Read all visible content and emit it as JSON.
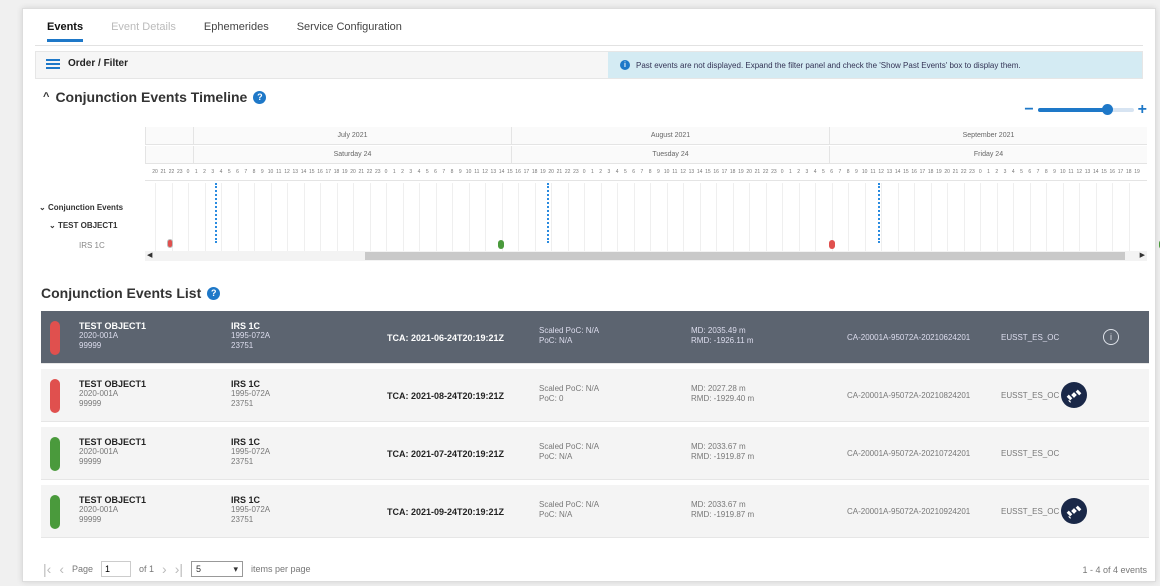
{
  "tabs": [
    {
      "label": "Events",
      "state": "active"
    },
    {
      "label": "Event Details",
      "state": "disabled"
    },
    {
      "label": "Ephemerides",
      "state": "normal"
    },
    {
      "label": "Service Configuration",
      "state": "normal"
    }
  ],
  "filter": {
    "label": "Order / Filter",
    "notice": "Past events are not displayed. Expand the filter panel and check the 'Show Past Events' box to display them."
  },
  "timeline": {
    "title": "Conjunction Events Timeline",
    "months": [
      "July 2021",
      "August 2021",
      "September 2021"
    ],
    "days": [
      "Saturday 24",
      "Tuesday 24",
      "Friday 24"
    ],
    "tree": [
      "Conjunction Events",
      "TEST OBJECT1",
      "IRS 1C"
    ],
    "zoom_level": 0.72
  },
  "colors": {
    "accent": "#1e78c8",
    "red": "#e0504e",
    "green": "#4a9a3c",
    "selected_row": "#5c6470"
  },
  "list": {
    "title": "Conjunction Events List",
    "rows": [
      {
        "primary": "TEST OBJECT1",
        "p_id": "2020-001A",
        "p_num": "99999",
        "secondary": "IRS 1C",
        "s_id": "1995-072A",
        "s_num": "23751",
        "tca": "TCA: 2021-06-24T20:19:21Z",
        "spoc": "Scaled PoC: N/A",
        "poc": "PoC: N/A",
        "md": "MD: 2035.49 m",
        "rmd": "RMD: -1926.11 m",
        "cdm": "CA-20001A-95072A-20210624201",
        "service": "EUSST_ES_OC",
        "status": "red",
        "selected": true,
        "action": "info-icon"
      },
      {
        "primary": "TEST OBJECT1",
        "p_id": "2020-001A",
        "p_num": "99999",
        "secondary": "IRS 1C",
        "s_id": "1995-072A",
        "s_num": "23751",
        "tca": "TCA: 2021-08-24T20:19:21Z",
        "spoc": "Scaled PoC: N/A",
        "poc": "PoC: 0",
        "md": "MD: 2027.28 m",
        "rmd": "RMD: -1929.40 m",
        "cdm": "CA-20001A-95072A-20210824201",
        "service": "EUSST_ES_OC",
        "status": "red",
        "selected": false,
        "action": "satellite-icon"
      },
      {
        "primary": "TEST OBJECT1",
        "p_id": "2020-001A",
        "p_num": "99999",
        "secondary": "IRS 1C",
        "s_id": "1995-072A",
        "s_num": "23751",
        "tca": "TCA: 2021-07-24T20:19:21Z",
        "spoc": "Scaled PoC: N/A",
        "poc": "PoC: N/A",
        "md": "MD: 2033.67 m",
        "rmd": "RMD: -1919.87 m",
        "cdm": "CA-20001A-95072A-20210724201",
        "service": "EUSST_ES_OC",
        "status": "green",
        "selected": false,
        "action": ""
      },
      {
        "primary": "TEST OBJECT1",
        "p_id": "2020-001A",
        "p_num": "99999",
        "secondary": "IRS 1C",
        "s_id": "1995-072A",
        "s_num": "23751",
        "tca": "TCA: 2021-09-24T20:19:21Z",
        "spoc": "Scaled PoC: N/A",
        "poc": "PoC: N/A",
        "md": "MD: 2033.67 m",
        "rmd": "RMD: -1919.87 m",
        "cdm": "CA-20001A-95072A-20210924201",
        "service": "EUSST_ES_OC",
        "status": "green",
        "selected": false,
        "action": "satellite-icon"
      }
    ]
  },
  "pager": {
    "page_label": "Page",
    "page": "1",
    "of": "of 1",
    "page_size": "5",
    "per_page": "items per page",
    "count": "1 - 4 of 4 events"
  }
}
